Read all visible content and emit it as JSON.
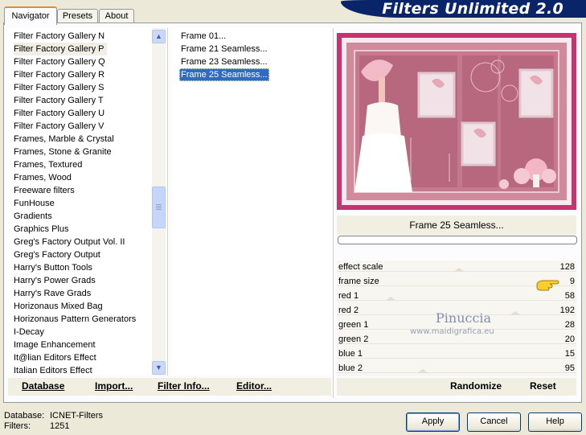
{
  "app": {
    "title": "Filters Unlimited 2.0"
  },
  "tabs": [
    {
      "label": "Navigator",
      "active": true
    },
    {
      "label": "Presets",
      "active": false
    },
    {
      "label": "About",
      "active": false
    }
  ],
  "categories": {
    "items": [
      "Filter Factory Gallery N",
      "Filter Factory Gallery P",
      "Filter Factory Gallery Q",
      "Filter Factory Gallery R",
      "Filter Factory Gallery S",
      "Filter Factory Gallery T",
      "Filter Factory Gallery U",
      "Filter Factory Gallery V",
      "Frames, Marble & Crystal",
      "Frames, Stone & Granite",
      "Frames, Textured",
      "Frames, Wood",
      "Freeware filters",
      "FunHouse",
      "Gradients",
      "Graphics Plus",
      "Greg's Factory Output Vol. II",
      "Greg's Factory Output",
      "Harry's Button Tools",
      "Harry's Power Grads",
      "Harry's Rave Grads",
      "Horizonaus Mixed Bag",
      "Horizonaus Pattern Generators",
      "I-Decay",
      "Image Enhancement",
      "It@lian Editors Effect",
      "Italian Editors Effect"
    ],
    "selected": "Filter Factory Gallery P"
  },
  "filters": {
    "items": [
      "Frame 01...",
      "Frame 21 Seamless...",
      "Frame 23 Seamless...",
      "Frame 25 Seamless..."
    ],
    "selected": "Frame 25 Seamless..."
  },
  "preview": {
    "filter_name": "Frame 25 Seamless...",
    "progress": 0
  },
  "params": [
    {
      "name": "effect scale",
      "value": "128"
    },
    {
      "name": "frame size",
      "value": "9"
    },
    {
      "name": "red 1",
      "value": "58"
    },
    {
      "name": "red 2",
      "value": "192"
    },
    {
      "name": "green 1",
      "value": "28"
    },
    {
      "name": "green 2",
      "value": "20"
    },
    {
      "name": "blue 1",
      "value": "15"
    },
    {
      "name": "blue 2",
      "value": "95"
    }
  ],
  "bottom_buttons": {
    "database": "Database",
    "import": "Import...",
    "filter_info": "Filter Info...",
    "editor": "Editor...",
    "randomize": "Randomize",
    "reset": "Reset"
  },
  "info": {
    "database_label": "Database:",
    "database_value": "ICNET-Filters",
    "filters_label": "Filters:",
    "filters_value": "1251"
  },
  "dialog_buttons": {
    "apply": "Apply",
    "cancel": "Cancel",
    "help": "Help"
  },
  "watermark": {
    "name": "Pinuccia",
    "site": "www.maidigrafica.eu"
  },
  "colors": {
    "banner": "#0a246a",
    "selection": "#316ac5",
    "frame_pink": "#c8326e"
  }
}
